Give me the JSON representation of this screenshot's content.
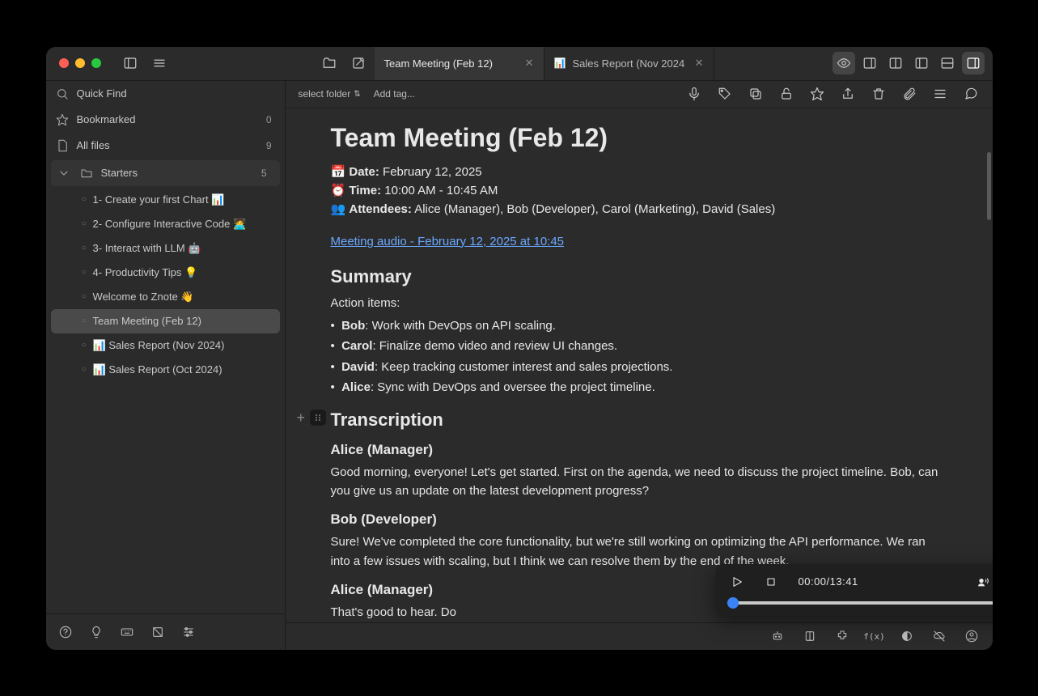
{
  "tabs": [
    {
      "label": "Team Meeting (Feb 12)",
      "active": true
    },
    {
      "label": "Sales Report (Nov 2024",
      "icon": "📊",
      "active": false
    }
  ],
  "sidebar": {
    "quick_find": "Quick Find",
    "bookmarked": {
      "label": "Bookmarked",
      "count": "0"
    },
    "all_files": {
      "label": "All files",
      "count": "9"
    },
    "group": {
      "label": "Starters",
      "count": "5"
    },
    "files": [
      {
        "label": "1- Create your first Chart 📊"
      },
      {
        "label": "2- Configure Interactive Code 🧑‍💻"
      },
      {
        "label": "3- Interact with LLM 🤖"
      },
      {
        "label": "4- Productivity Tips 💡"
      },
      {
        "label": "Welcome to Znote 👋"
      },
      {
        "label": "Team Meeting (Feb 12)",
        "selected": true
      },
      {
        "label": "📊 Sales Report (Nov 2024)"
      },
      {
        "label": "📊 Sales Report (Oct 2024)"
      }
    ]
  },
  "crumbs": {
    "folder": "select folder",
    "tag": "Add tag..."
  },
  "note": {
    "title": "Team Meeting (Feb 12)",
    "date_label": "Date:",
    "date_value": "February 12, 2025",
    "time_label": "Time:",
    "time_value": "10:00 AM - 10:45 AM",
    "attendees_label": "Attendees:",
    "attendees_value": "Alice (Manager), Bob (Developer), Carol (Marketing), David (Sales)",
    "audio_link": "Meeting audio - February 12, 2025 at 10:45",
    "summary_heading": "Summary",
    "action_intro": "Action items:",
    "actions": [
      {
        "name": "Bob",
        "text": ": Work with DevOps on API scaling."
      },
      {
        "name": "Carol",
        "text": ": Finalize demo video and review UI changes."
      },
      {
        "name": "David",
        "text": ": Keep tracking customer interest and sales projections."
      },
      {
        "name": "Alice",
        "text": ": Sync with DevOps and oversee the project timeline."
      }
    ],
    "transcription_heading": "Transcription",
    "transcript": [
      {
        "speaker": "Alice (Manager)",
        "text": "Good morning, everyone! Let's get started. First on the agenda, we need to discuss the project timeline. Bob, can you give us an update on the latest development progress?"
      },
      {
        "speaker": "Bob (Developer)",
        "text": "Sure! We've completed the core functionality, but we're still working on optimizing the API performance. We ran into a few issues with scaling, but I think we can resolve them by the end of the week."
      },
      {
        "speaker": "Alice (Manager)",
        "text": "That's good to hear. Do"
      }
    ]
  },
  "player": {
    "time": "00:00/13:41"
  }
}
